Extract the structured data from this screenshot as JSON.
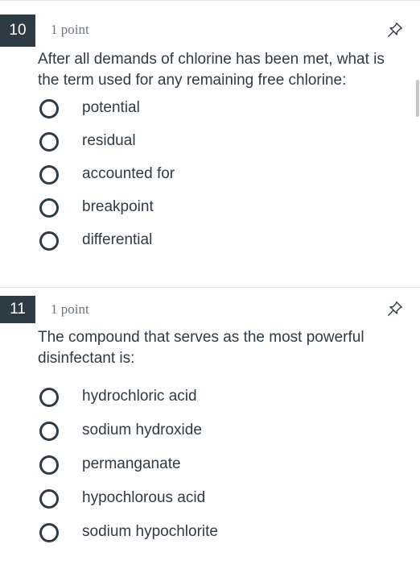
{
  "questions": [
    {
      "number": "10",
      "points": "1 point",
      "text": "After all demands of chlorine has been met, what is the term used for any remaining free chlorine:",
      "answers": [
        "potential",
        "residual",
        "accounted for",
        "breakpoint",
        "differential"
      ]
    },
    {
      "number": "11",
      "points": "1 point",
      "text": "The compound that serves as the most powerful disinfectant is:",
      "answers": [
        "hydrochloric acid",
        "sodium hydroxide",
        "permanganate",
        "hypochlorous acid",
        "sodium hypochlorite"
      ]
    }
  ],
  "icons": {
    "pin": "pin-icon",
    "radio": "radio-unselected-icon"
  },
  "colors": {
    "text": "#2d3b45",
    "number_badge": "#2d3b45",
    "muted": "#6b7780"
  }
}
